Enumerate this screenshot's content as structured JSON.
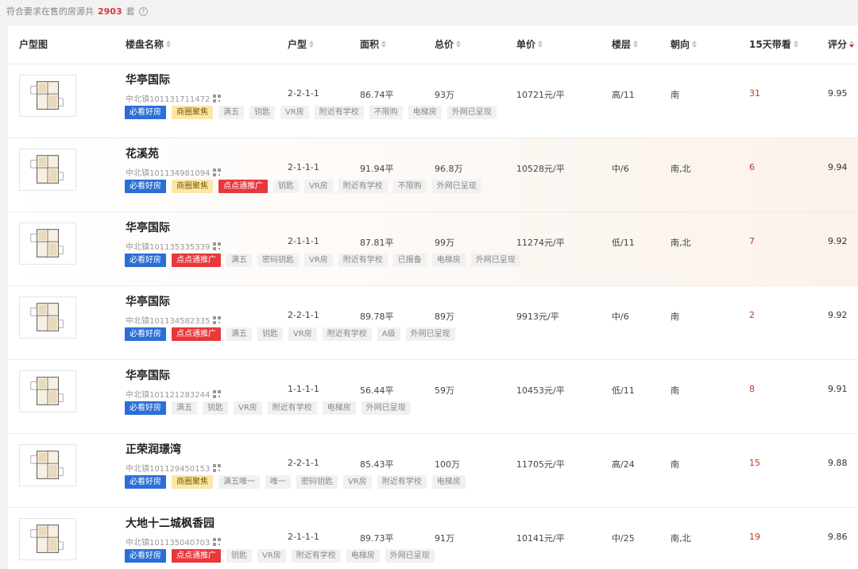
{
  "summary": {
    "prefix": "符合要求在售的房源共",
    "count": "2903",
    "suffix": "套"
  },
  "colors": {
    "blue_tag": "#2b6fd6",
    "yellow_tag": "#fde7a6",
    "red_tag": "#e8383d",
    "count_red": "#d9363e"
  },
  "headers": {
    "floorplan": "户型图",
    "name": "楼盘名称",
    "layout": "户型",
    "area": "面积",
    "total": "总价",
    "unit": "单价",
    "floor": "楼层",
    "orient": "朝向",
    "views": "15天带看",
    "score": "评分"
  },
  "rows": [
    {
      "name": "华亭国际",
      "code": "中北镇101131711472",
      "layout": "2-2-1-1",
      "area": "86.74平",
      "total": "93万",
      "unit": "10721元/平",
      "floor": "高/11",
      "orient": "南",
      "views": "31",
      "score": "9.95",
      "tags": [
        {
          "t": "必看好房",
          "c": "blue"
        },
        {
          "t": "商圈聚焦",
          "c": "yellow"
        },
        {
          "t": "满五",
          "c": "gray"
        },
        {
          "t": "钥匙",
          "c": "gray"
        },
        {
          "t": "VR房",
          "c": "gray"
        },
        {
          "t": "附近有学校",
          "c": "gray"
        },
        {
          "t": "不限购",
          "c": "gray"
        },
        {
          "t": "电梯房",
          "c": "gray"
        },
        {
          "t": "外网已呈现",
          "c": "gray"
        }
      ]
    },
    {
      "name": "花溪苑",
      "code": "中北镇101134981094",
      "layout": "2-1-1-1",
      "area": "91.94平",
      "total": "96.8万",
      "unit": "10528元/平",
      "floor": "中/6",
      "orient": "南,北",
      "views": "6",
      "score": "9.94",
      "tags": [
        {
          "t": "必看好房",
          "c": "blue"
        },
        {
          "t": "商圈聚焦",
          "c": "yellow"
        },
        {
          "t": "点点通推广",
          "c": "red"
        },
        {
          "t": "钥匙",
          "c": "gray"
        },
        {
          "t": "VR房",
          "c": "gray"
        },
        {
          "t": "附近有学校",
          "c": "gray"
        },
        {
          "t": "不限购",
          "c": "gray"
        },
        {
          "t": "外网已呈现",
          "c": "gray"
        }
      ]
    },
    {
      "name": "华亭国际",
      "code": "中北镇101135335339",
      "layout": "2-1-1-1",
      "area": "87.81平",
      "total": "99万",
      "unit": "11274元/平",
      "floor": "低/11",
      "orient": "南,北",
      "views": "7",
      "score": "9.92",
      "tags": [
        {
          "t": "必看好房",
          "c": "blue"
        },
        {
          "t": "点点通推广",
          "c": "red"
        },
        {
          "t": "满五",
          "c": "gray"
        },
        {
          "t": "密码钥匙",
          "c": "gray"
        },
        {
          "t": "VR房",
          "c": "gray"
        },
        {
          "t": "附近有学校",
          "c": "gray"
        },
        {
          "t": "已报备",
          "c": "gray"
        },
        {
          "t": "电梯房",
          "c": "gray"
        },
        {
          "t": "外网已呈现",
          "c": "gray"
        }
      ]
    },
    {
      "name": "华亭国际",
      "code": "中北镇101134582335",
      "layout": "2-2-1-1",
      "area": "89.78平",
      "total": "89万",
      "unit": "9913元/平",
      "floor": "中/6",
      "orient": "南",
      "views": "2",
      "score": "9.92",
      "tags": [
        {
          "t": "必看好房",
          "c": "blue"
        },
        {
          "t": "点点通推广",
          "c": "red"
        },
        {
          "t": "满五",
          "c": "gray"
        },
        {
          "t": "钥匙",
          "c": "gray"
        },
        {
          "t": "VR房",
          "c": "gray"
        },
        {
          "t": "附近有学校",
          "c": "gray"
        },
        {
          "t": "A级",
          "c": "gray"
        },
        {
          "t": "外网已呈现",
          "c": "gray"
        }
      ]
    },
    {
      "name": "华亭国际",
      "code": "中北镇101121283244",
      "layout": "1-1-1-1",
      "area": "56.44平",
      "total": "59万",
      "unit": "10453元/平",
      "floor": "低/11",
      "orient": "南",
      "views": "8",
      "score": "9.91",
      "tags": [
        {
          "t": "必看好房",
          "c": "blue"
        },
        {
          "t": "满五",
          "c": "gray"
        },
        {
          "t": "钥匙",
          "c": "gray"
        },
        {
          "t": "VR房",
          "c": "gray"
        },
        {
          "t": "附近有学校",
          "c": "gray"
        },
        {
          "t": "电梯房",
          "c": "gray"
        },
        {
          "t": "外网已呈现",
          "c": "gray"
        }
      ]
    },
    {
      "name": "正荣润璟湾",
      "code": "中北镇101129450153",
      "layout": "2-2-1-1",
      "area": "85.43平",
      "total": "100万",
      "unit": "11705元/平",
      "floor": "高/24",
      "orient": "南",
      "views": "15",
      "score": "9.88",
      "tags": [
        {
          "t": "必看好房",
          "c": "blue"
        },
        {
          "t": "商圈聚焦",
          "c": "yellow"
        },
        {
          "t": "满五唯一",
          "c": "gray"
        },
        {
          "t": "唯一",
          "c": "gray"
        },
        {
          "t": "密码钥匙",
          "c": "gray"
        },
        {
          "t": "VR房",
          "c": "gray"
        },
        {
          "t": "附近有学校",
          "c": "gray"
        },
        {
          "t": "电梯房",
          "c": "gray"
        }
      ]
    },
    {
      "name": "大地十二城枫香园",
      "code": "中北镇101135040703",
      "layout": "2-1-1-1",
      "area": "89.73平",
      "total": "91万",
      "unit": "10141元/平",
      "floor": "中/25",
      "orient": "南,北",
      "views": "19",
      "score": "9.86",
      "tags": [
        {
          "t": "必看好房",
          "c": "blue"
        },
        {
          "t": "点点通推广",
          "c": "red"
        },
        {
          "t": "钥匙",
          "c": "gray"
        },
        {
          "t": "VR房",
          "c": "gray"
        },
        {
          "t": "附近有学校",
          "c": "gray"
        },
        {
          "t": "电梯房",
          "c": "gray"
        },
        {
          "t": "外网已呈现",
          "c": "gray"
        }
      ]
    }
  ]
}
